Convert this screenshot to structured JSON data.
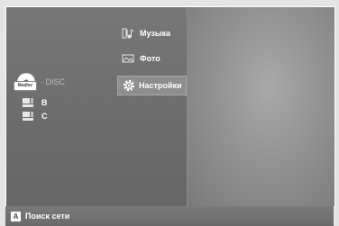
{
  "menu": {
    "items": [
      {
        "label": "Музыка",
        "icon": "music-icon"
      },
      {
        "label": "Фото",
        "icon": "photo-icon"
      },
      {
        "label": "Настройки",
        "icon": "gear-icon",
        "selected": true
      }
    ]
  },
  "source": {
    "disc_badge": "Nodisc",
    "disc_label": "- DISC",
    "drives": [
      {
        "label": "B",
        "icon": "drive-icon"
      },
      {
        "label": "C",
        "icon": "drive-icon"
      }
    ]
  },
  "footer": {
    "key": "A",
    "action_label": "Поиск сети"
  },
  "colors": {
    "panel": "#6f6f6f",
    "preview": "#a9a9a9",
    "selected": "#8e8e8e"
  }
}
